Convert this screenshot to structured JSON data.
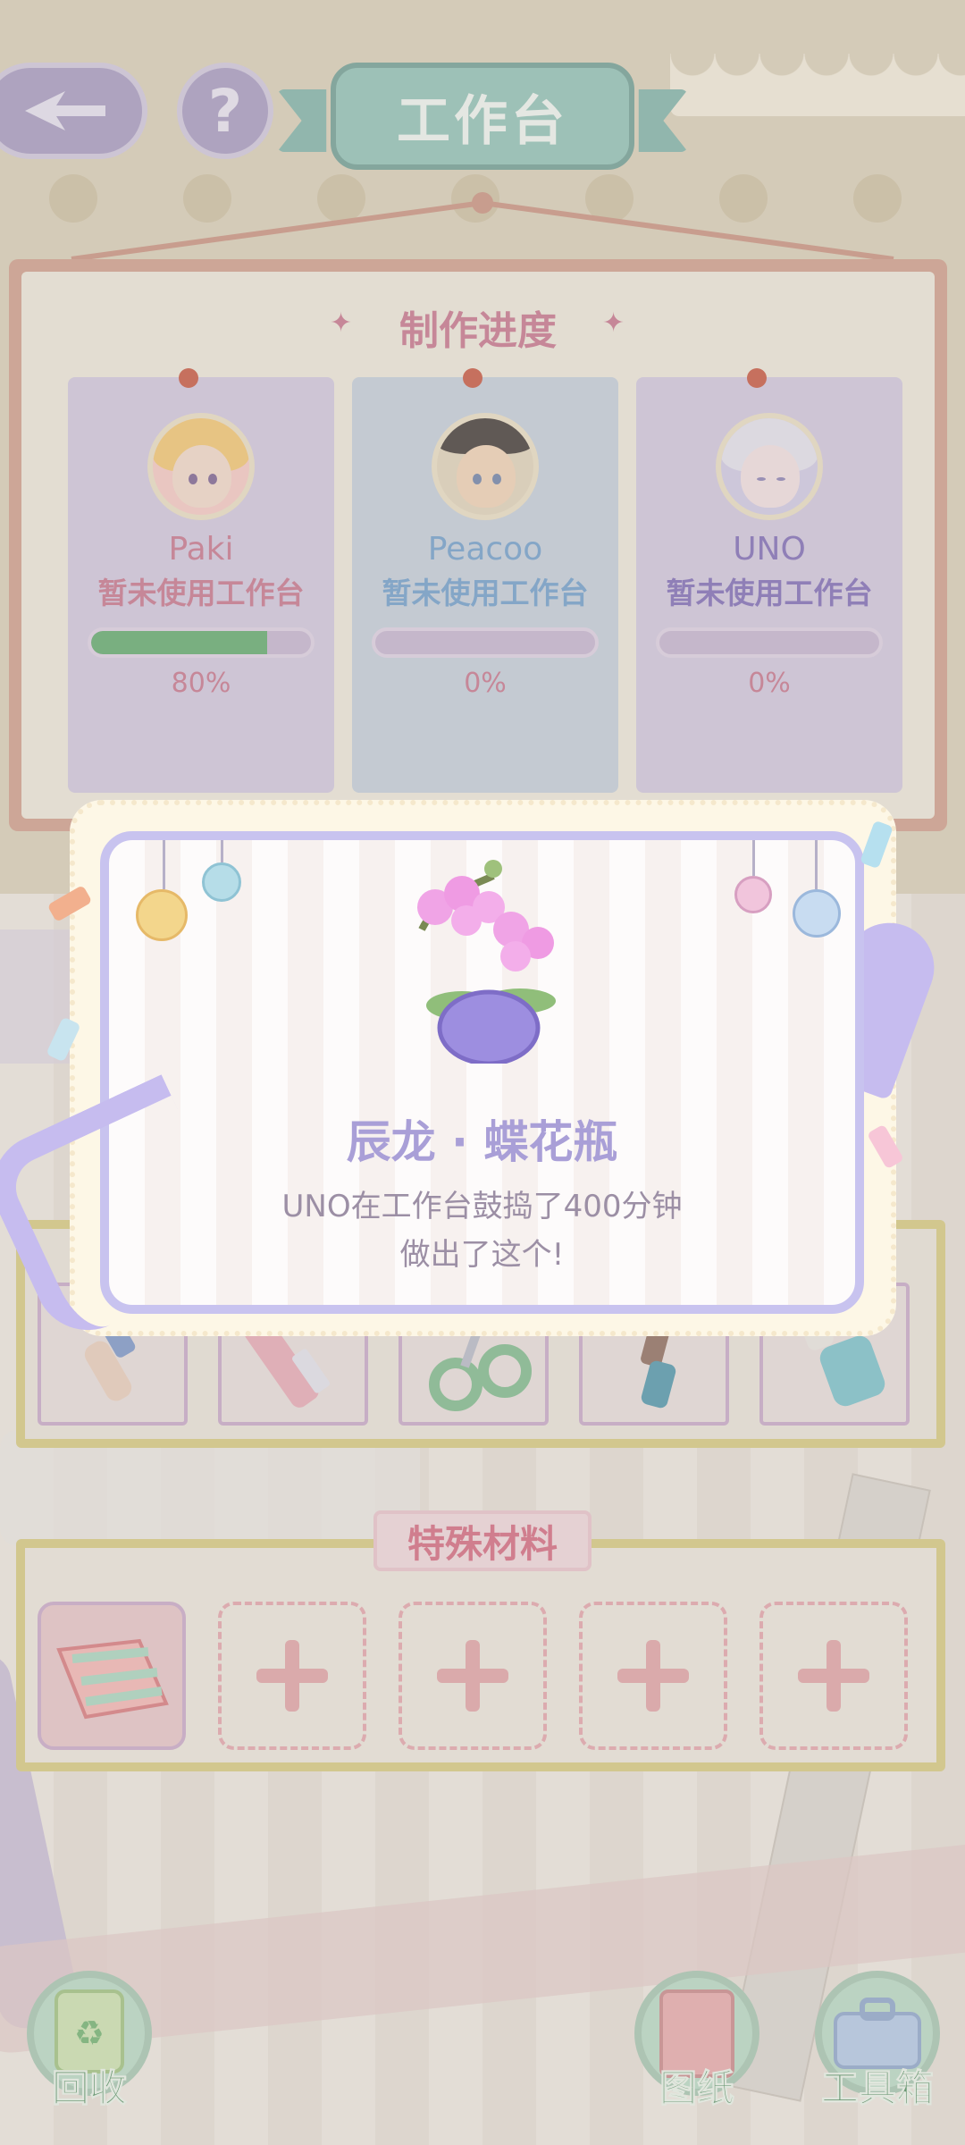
{
  "header": {
    "title": "工作台",
    "help_symbol": "?"
  },
  "progress": {
    "title": "制作进度",
    "characters": [
      {
        "name": "Paki",
        "status": "暂未使用工作台",
        "progress": 0.8,
        "percent_label": "80%",
        "name_color": "#c6738a",
        "status_color": "#c6738a",
        "card_color": "#cdc2d9"
      },
      {
        "name": "Peacoo",
        "status": "暂未使用工作台",
        "progress": 0.0,
        "percent_label": "0%",
        "name_color": "#6e9cc9",
        "status_color": "#6e9cc9",
        "card_color": "#c1ccd6"
      },
      {
        "name": "UNO",
        "status": "暂未使用工作台",
        "progress": 0.0,
        "percent_label": "0%",
        "name_color": "#7d69b3",
        "status_color": "#7d69b3",
        "card_color": "#cdc2d9"
      }
    ]
  },
  "reward": {
    "item_name": "辰龙 · 蝶花瓶",
    "line1": "UNO在工作台鼓捣了400分钟",
    "line2": "做出了这个!"
  },
  "tools": {
    "items": [
      "paintbrush-icon",
      "utility-knife-icon",
      "scissors-icon",
      "pen-icon",
      "glue-bottle-icon"
    ]
  },
  "special_materials": {
    "label": "特殊材料",
    "slots": [
      "ribbon-fabric",
      "empty",
      "empty",
      "empty",
      "empty"
    ]
  },
  "bottom_bar": {
    "recycle_label": "回收",
    "blueprint_label": "图纸",
    "toolbox_label": "工具箱"
  },
  "colors": {
    "accent_pink": "#c6738a",
    "modal_border": "#c8c3ef",
    "progress_fill": "#5fa86a",
    "frame_gold": "#d6c87c"
  }
}
